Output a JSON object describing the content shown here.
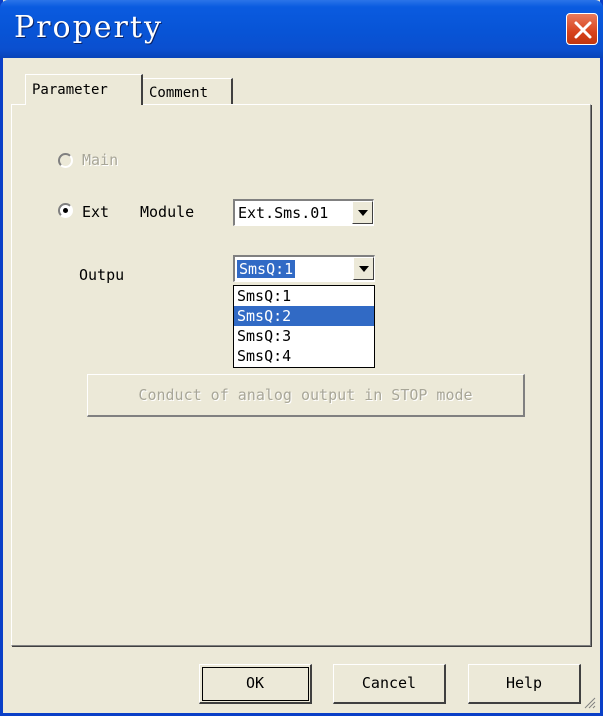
{
  "window": {
    "title": "Property"
  },
  "tabs": [
    {
      "label": "Parameter",
      "active": true
    },
    {
      "label": "Comment",
      "active": false
    }
  ],
  "form": {
    "main_label": "Main",
    "ext_label": "Ext",
    "module_label": "Module",
    "module_value": "Ext.Sms.01",
    "output_label": "Outpu",
    "output_value": "SmsQ:1",
    "output_options": [
      "SmsQ:1",
      "SmsQ:2",
      "SmsQ:3",
      "SmsQ:4"
    ],
    "highlighted_option": "SmsQ:2",
    "stop_mode_button": "Conduct of analog output in STOP  mode"
  },
  "buttons": {
    "ok": "OK",
    "cancel": "Cancel",
    "help": "Help"
  },
  "colors": {
    "title_blue": "#0854d6",
    "dialog_bg": "#ece9d8",
    "selection": "#316ac5",
    "close_red": "#d8431c"
  },
  "icons": {
    "close": "close-icon",
    "dropdown": "chevron-down-icon",
    "grip": "resize-grip-icon"
  }
}
